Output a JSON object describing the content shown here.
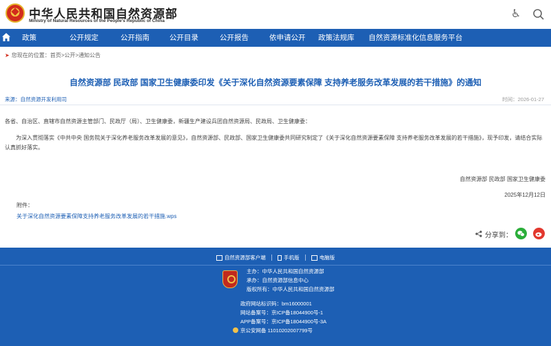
{
  "header": {
    "site_name_cn": "中华人民共和国自然资源部",
    "site_name_en": "Ministry of Natural Resources of the People's Republic of China"
  },
  "nav": {
    "items": [
      "政策",
      "公开规定",
      "公开指南",
      "公开目录",
      "公开报告",
      "依申请公开",
      "政策法规库",
      "自然资源标准化信息服务平台"
    ]
  },
  "breadcrumb": {
    "prefix": "您现在的位置：",
    "path": "首页>公开>通知公告"
  },
  "article": {
    "title": "自然资源部 民政部 国家卫生健康委印发《关于深化自然资源要素保障 支持养老服务改革发展的若干措施》的通知",
    "source": "来源：自然资源开发利用司",
    "time": "时间：2026-01-27",
    "recipients": "各省、自治区、直辖市自然资源主管部门、民政厅（局）、卫生健康委，新疆生产建设兵团自然资源局、民政局、卫生健康委：",
    "body": "为深入贯彻落实《中共中央 国务院关于深化养老服务改革发展的意见》，自然资源部、民政部、国家卫生健康委共同研究制定了《关于深化自然资源要素保障 支持养老服务改革发展的若干措施》，现予印发，请结合实际认真抓好落实。",
    "signature": "自然资源部 民政部 国家卫生健康委",
    "date": "2025年12月12日",
    "attachment_label": "附件：",
    "attachment_link": "关于深化自然资源要素保障支持养老服务改革发展的若干措施.wps",
    "share_label": "分享到："
  },
  "footer": {
    "links": [
      "自然资源部客户端",
      "手机版",
      "电脑版"
    ],
    "sponsor": "主办：中华人民共和国自然资源部",
    "organizer": "承办：自然资源部信息中心",
    "copyright": "版权所有：中华人民共和国自然资源部",
    "site_code": "政府网站标识码：bm16000001",
    "icp": "网站备案号：京ICP备18044900号-1",
    "app_icp": "APP备案号：京ICP备18044900号-3A",
    "police": "京公安网备 11010202007799号"
  },
  "colors": {
    "brand_blue": "#1d5fb4",
    "emblem_red": "#d22c1c",
    "wechat_green": "#2bae3a",
    "weibo_red": "#e2382e"
  },
  "icons": [
    "national-emblem-icon",
    "accessibility-icon",
    "search-icon",
    "home-icon",
    "location-pin-icon",
    "share-icon",
    "wechat-icon",
    "weibo-icon",
    "party-emblem-icon",
    "police-badge-icon"
  ]
}
